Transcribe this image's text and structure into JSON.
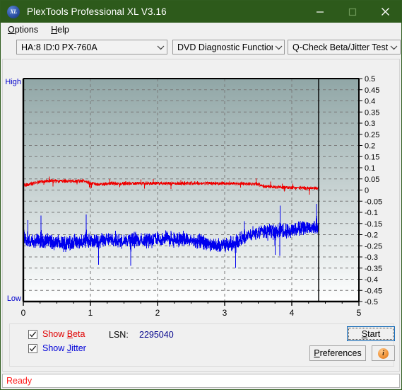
{
  "window": {
    "title": "PlexTools Professional XL V3.16",
    "icon": "xl-logo-icon",
    "minimize": "–",
    "maximize": "□",
    "close": "✕"
  },
  "menu": {
    "items": [
      {
        "label": "Options",
        "accel": "O"
      },
      {
        "label": "Help",
        "accel": "H"
      }
    ]
  },
  "toolbar": {
    "drive": {
      "value": "HA:8 ID:0  PX-760A",
      "caret": "chevron-down-icon"
    },
    "function": {
      "value": "DVD Diagnostic Functions",
      "caret": "chevron-down-icon"
    },
    "test": {
      "value": "Q-Check Beta/Jitter Test",
      "caret": "chevron-down-icon"
    }
  },
  "controls": {
    "show_beta": {
      "label": "Show Beta",
      "accel": "B",
      "checked": true,
      "color": "#e00000"
    },
    "show_jitter": {
      "label": "Show Jitter",
      "accel": "J",
      "checked": true,
      "color": "#0000d8"
    },
    "lsn_label": "LSN:",
    "lsn_value": "2295040",
    "start_button": {
      "label": "Start",
      "accel": "S"
    },
    "preferences_button": {
      "label": "Preferences",
      "accel": "P"
    },
    "info_button": {
      "glyph": "i",
      "name": "info-icon"
    }
  },
  "status": {
    "text": "Ready",
    "color": "#ff2020"
  },
  "chart_data": {
    "type": "line",
    "title": "",
    "xlabel": "",
    "ylabel": "",
    "xlim": [
      0,
      5
    ],
    "ylim": [
      -0.5,
      0.5
    ],
    "xticks": [
      0,
      1,
      2,
      3,
      4,
      5
    ],
    "xtick_labels": [
      "0",
      "1",
      "2",
      "3",
      "4",
      "5"
    ],
    "yticks": [
      0.5,
      0.45,
      0.4,
      0.35,
      0.3,
      0.25,
      0.2,
      0.15,
      0.1,
      0.05,
      0,
      -0.05,
      -0.1,
      -0.15,
      -0.2,
      -0.25,
      -0.3,
      -0.35,
      -0.4,
      -0.45,
      -0.5
    ],
    "ytick_labels": [
      "0.5",
      "0.45",
      "0.4",
      "0.35",
      "0.3",
      "0.25",
      "0.2",
      "0.15",
      "0.1",
      "0.05",
      "0",
      "-0.05",
      "-0.1",
      "-0.15",
      "-0.2",
      "-0.25",
      "-0.3",
      "-0.35",
      "-0.4",
      "-0.45",
      "-0.5"
    ],
    "axis_edge_labels": {
      "top_left": "High",
      "bottom_left": "Low"
    },
    "grid": true,
    "grid_style": "dashed",
    "grid_color": "#7a7a7a",
    "background_gradient": [
      "#90a6a6",
      "#ffffff"
    ],
    "data_end_marker_x": 4.4,
    "legend_position": "below-plot",
    "series": [
      {
        "name": "Beta",
        "color": "#ee0000",
        "noise": 0.009,
        "x": [
          0.0,
          0.1,
          0.2,
          0.3,
          0.4,
          0.5,
          0.6,
          0.7,
          0.8,
          0.9,
          1.0,
          1.1,
          1.2,
          1.3,
          1.4,
          1.5,
          1.6,
          1.7,
          1.8,
          1.9,
          2.0,
          2.1,
          2.2,
          2.3,
          2.4,
          2.5,
          2.6,
          2.7,
          2.8,
          2.9,
          3.0,
          3.1,
          3.2,
          3.3,
          3.4,
          3.5,
          3.6,
          3.7,
          3.8,
          3.9,
          4.0,
          4.1,
          4.2,
          4.3,
          4.4
        ],
        "values": [
          0.02,
          0.026,
          0.034,
          0.039,
          0.041,
          0.04,
          0.04,
          0.04,
          0.04,
          0.04,
          0.033,
          0.024,
          0.027,
          0.03,
          0.029,
          0.029,
          0.03,
          0.03,
          0.03,
          0.03,
          0.03,
          0.03,
          0.03,
          0.03,
          0.03,
          0.03,
          0.03,
          0.03,
          0.03,
          0.03,
          0.03,
          0.029,
          0.029,
          0.028,
          0.027,
          0.026,
          0.016,
          0.014,
          0.013,
          0.012,
          0.011,
          0.01,
          0.009,
          0.008,
          0.008
        ]
      },
      {
        "name": "Jitter",
        "color": "#0000ee",
        "noise": 0.042,
        "x": [
          0.0,
          0.1,
          0.2,
          0.3,
          0.4,
          0.5,
          0.6,
          0.7,
          0.8,
          0.9,
          1.0,
          1.1,
          1.2,
          1.3,
          1.4,
          1.5,
          1.6,
          1.7,
          1.8,
          1.9,
          2.0,
          2.1,
          2.2,
          2.3,
          2.4,
          2.5,
          2.6,
          2.7,
          2.8,
          2.9,
          3.0,
          3.1,
          3.2,
          3.3,
          3.4,
          3.5,
          3.6,
          3.7,
          3.8,
          3.9,
          4.0,
          4.1,
          4.2,
          4.3,
          4.4
        ],
        "values": [
          -0.215,
          -0.225,
          -0.23,
          -0.228,
          -0.232,
          -0.238,
          -0.24,
          -0.236,
          -0.234,
          -0.232,
          -0.23,
          -0.228,
          -0.226,
          -0.225,
          -0.224,
          -0.224,
          -0.223,
          -0.222,
          -0.222,
          -0.221,
          -0.22,
          -0.22,
          -0.22,
          -0.22,
          -0.222,
          -0.226,
          -0.232,
          -0.24,
          -0.248,
          -0.252,
          -0.25,
          -0.24,
          -0.226,
          -0.212,
          -0.2,
          -0.192,
          -0.186,
          -0.188,
          -0.186,
          -0.182,
          -0.178,
          -0.174,
          -0.17,
          -0.166,
          -0.164
        ]
      }
    ]
  }
}
